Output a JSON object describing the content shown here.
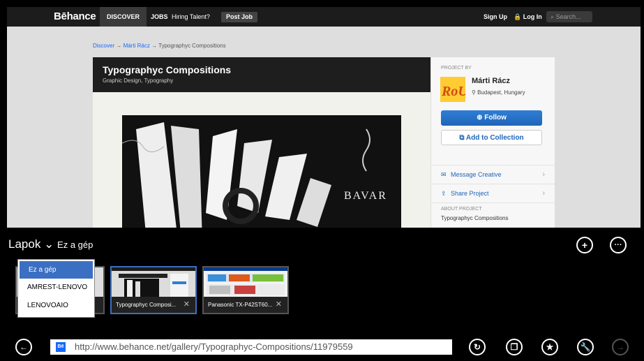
{
  "behance": {
    "logo": "Bēhance",
    "nav": {
      "discover": "DISCOVER",
      "jobs": "JOBS",
      "hiring": "Hiring Talent?",
      "post_job": "Post Job",
      "signup": "Sign Up",
      "login": "Log In",
      "search_placeholder": "Search..."
    },
    "breadcrumb": {
      "root": "Discover",
      "author": "Márti Rácz",
      "current": "Typographyc Compositions",
      "sep": "→"
    },
    "project": {
      "title": "Typographyc Compositions",
      "fields": "Graphic Design, Typography"
    },
    "sidebar": {
      "project_by_label": "PROJECT BY",
      "author": "Márti Rácz",
      "location": "Budapest, Hungary",
      "follow": "Follow",
      "add_to_collection": "Add to Collection",
      "message": "Message Creative",
      "share": "Share Project",
      "about_label": "ABOUT PROJECT",
      "about_value": "Typographyc Compositions",
      "chev": "›"
    }
  },
  "ie": {
    "tabs_title": "Lapok",
    "source": "Ez a gép",
    "dropdown": [
      "Ez a gép",
      "AMREST-LENOVO",
      "LENOVOAIO"
    ],
    "thumbs": [
      {
        "caption": "Typographyc Composi..."
      },
      {
        "caption": "Panasonic TX-P42ST60..."
      }
    ],
    "url": "http://www.behance.net/gallery/Typographyc-Compositions/11979559",
    "favicon": "Bē",
    "close": "✕",
    "accent": "#3b6fc2"
  }
}
